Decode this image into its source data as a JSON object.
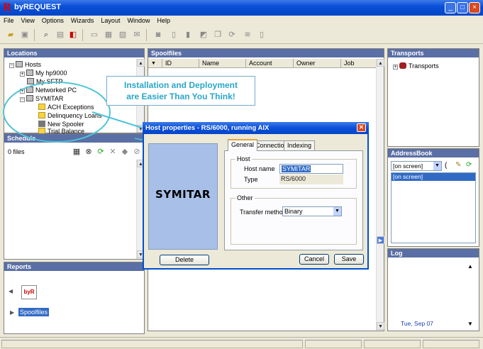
{
  "window": {
    "title": "byREQUEST",
    "logo_letter": "R",
    "minimize": "_",
    "maximize": "□",
    "close": "×"
  },
  "menu": [
    "File",
    "View",
    "Options",
    "Wizards",
    "Layout",
    "Window",
    "Help"
  ],
  "locations": {
    "header": "Locations",
    "hosts_label": "Hosts",
    "items": [
      "My hp9000",
      "My SFTP",
      "Networked PC",
      "SYMITAR"
    ],
    "folders": [
      "ACH Exceptions",
      "Delinquency Loans",
      "New Spooler",
      "Trial Balance"
    ]
  },
  "schedule": {
    "header": "Schedule",
    "files_label": "0 files"
  },
  "reports": {
    "header": "Reports",
    "item_label": "Spoolfiles"
  },
  "spoolfiles": {
    "header": "Spoolfiles",
    "columns": [
      "ID",
      "Name",
      "Account",
      "Owner",
      "Job"
    ]
  },
  "transports": {
    "header": "Transports",
    "item_label": "Transports"
  },
  "addressbook": {
    "header": "AddressBook",
    "select_value": "[on screen]",
    "list_item": "[on screen]"
  },
  "log": {
    "header": "Log",
    "date": "Tue, Sep 07"
  },
  "callout": {
    "line1": "Installation and Deployment",
    "line2": "are Easier Than You Think!"
  },
  "dialog": {
    "title": "Host properties - RS/6000, running AIX",
    "preview_text": "SYMITAR",
    "tabs": [
      "General",
      "Connection",
      "Indexing"
    ],
    "host_group": "Host",
    "host_name_label": "Host name",
    "host_name_value": "SYMITAR",
    "type_label": "Type",
    "type_value": "RS/6000",
    "other_group": "Other",
    "transfer_label": "Transfer method",
    "transfer_value": "Binary",
    "delete_button": "Delete",
    "cancel_button": "Cancel",
    "save_button": "Save"
  },
  "colors": {
    "titlebar": "#0a4fd8",
    "panel_header": "#5a6fa5",
    "callout_text": "#2aa6c8",
    "selection": "#316ac5"
  }
}
